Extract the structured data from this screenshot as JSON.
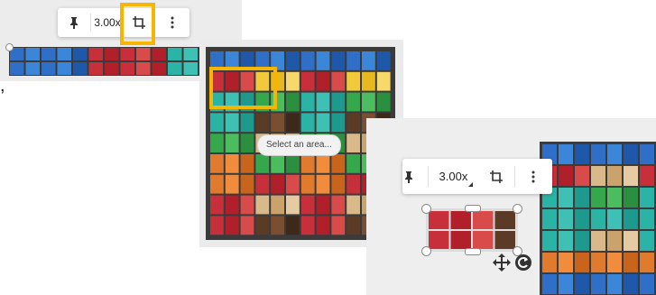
{
  "colors": {
    "highlight": "#f6b500",
    "shelf": "#3b3b3b",
    "toolbar_bg": "#ffffff"
  },
  "panel1": {
    "stray_text": ",",
    "toolbar": {
      "pin_icon": "pin-icon",
      "zoom_label": "3.00x",
      "crop_icon": "crop-icon",
      "more_icon": "more-vertical-icon",
      "crop_highlighted": true
    }
  },
  "panel2": {
    "tooltip": "Select an area..."
  },
  "panel3": {
    "toolbar": {
      "pin_icon": "pin-icon",
      "zoom_label": "3.00x",
      "crop_icon": "crop-icon",
      "more_icon": "more-vertical-icon"
    },
    "move_icon": "move-icon",
    "rotate_icon": "rotate-icon"
  }
}
